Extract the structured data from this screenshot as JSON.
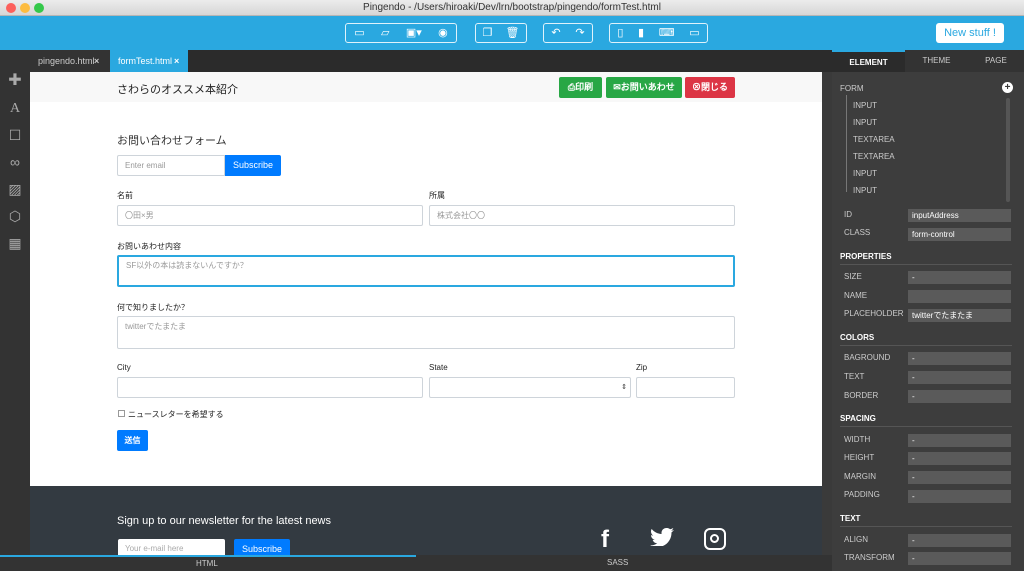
{
  "window": {
    "title": "Pingendo - /Users/hiroaki/Dev/lrn/bootstrap/pingendo/formTest.html"
  },
  "toolbar": {
    "file_icons": [
      "new-file-icon",
      "open-folder-icon",
      "save-icon",
      "preview-eye-icon"
    ],
    "edit_icons": [
      "duplicate-icon",
      "trash-icon"
    ],
    "history_icons": [
      "undo-icon",
      "redo-icon"
    ],
    "device_icons": [
      "phone-icon",
      "tablet-icon",
      "laptop-icon",
      "desktop-icon"
    ],
    "new_stuff": "New stuff !"
  },
  "tabs": [
    {
      "label": "pingendo.html",
      "close": "×",
      "active": false
    },
    {
      "label": "formTest.html",
      "close": "×",
      "active": true
    }
  ],
  "page": {
    "brand": "さわらのオススメ本紹介",
    "nav_buttons": {
      "print": "印刷",
      "contact": "お問いあわせ",
      "close": "閉じる"
    },
    "form_title": "お問い合わせフォーム",
    "subscribe_placeholder": "Enter email",
    "subscribe_button": "Subscribe",
    "name_label": "名前",
    "name_placeholder": "〇田×男",
    "company_label": "所属",
    "company_placeholder": "株式会社〇〇",
    "inquiry_label": "お問いあわせ内容",
    "inquiry_placeholder": "SF以外の本は読まないんですか？",
    "source_label": "何で知りましたか？",
    "source_placeholder": "twitterでたまたま",
    "city_label": "City",
    "state_label": "State",
    "zip_label": "Zip",
    "newsletter_check": "ニュースレターを希望する",
    "submit": "送信",
    "footer_title": "Sign up to our newsletter for the latest news",
    "footer_placeholder": "Your e-mail here",
    "footer_button": "Subscribe",
    "social_icons": [
      "facebook-icon",
      "twitter-icon",
      "instagram-icon"
    ]
  },
  "panel": {
    "tabs": [
      "ELEMENT",
      "THEME",
      "PAGE"
    ],
    "tree_root": "FORM",
    "tree_items": [
      "INPUT",
      "INPUT",
      "TEXTAREA",
      "TEXTAREA",
      "INPUT",
      "INPUT"
    ],
    "id_label": "ID",
    "id_value": "inputAddress",
    "class_label": "CLASS",
    "class_value": "form-control",
    "properties_head": "PROPERTIES",
    "size_label": "SIZE",
    "size_value": "-",
    "name_label": "NAME",
    "placeholder_label": "PLACEHOLDER",
    "placeholder_value": "twitterでたまたま",
    "colors_head": "COLORS",
    "background_label": "BAGROUND",
    "text_label": "TEXT",
    "border_label": "BORDER",
    "spacing_head": "SPACING",
    "width_label": "WIDTH",
    "height_label": "HEIGHT",
    "margin_label": "MARGIN",
    "padding_label": "PADDING",
    "text_head": "TEXT",
    "align_label": "ALIGN",
    "transform_label": "TRANSFORM",
    "dash": "-"
  },
  "bottom": {
    "html_tab": "HTML",
    "sass_tab": "SASS"
  },
  "colors": {
    "toolbar": "#2aa8e0",
    "success": "#28a745",
    "danger": "#dc3545",
    "primary": "#007bff"
  }
}
